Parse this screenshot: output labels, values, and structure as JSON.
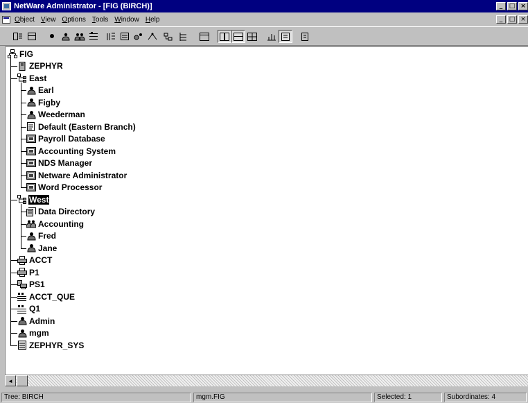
{
  "window": {
    "title": "NetWare Administrator - [FIG (BIRCH)]",
    "controls": [
      "_",
      "□",
      "×"
    ]
  },
  "menubar": {
    "items": [
      "Object",
      "View",
      "Options",
      "Tools",
      "Window",
      "Help"
    ],
    "doc_controls": [
      "_",
      "□",
      "×"
    ]
  },
  "toolbar": {
    "buttons": [
      {
        "name": "create-object-icon"
      },
      {
        "name": "details-icon"
      },
      {
        "name": "search-icon"
      },
      {
        "name": "user-icon"
      },
      {
        "name": "group-icon"
      },
      {
        "name": "queue-icon"
      },
      {
        "name": "browse-icon"
      },
      {
        "name": "browse-alt-icon"
      },
      {
        "name": "rights-icon"
      },
      {
        "name": "filter-icon"
      },
      {
        "name": "partition-icon"
      },
      {
        "name": "tree-view-icon"
      },
      {
        "name": "window-icon"
      },
      {
        "name": "tile-icon"
      },
      {
        "name": "cascade-icon"
      },
      {
        "name": "grid-icon"
      },
      {
        "name": "chart-icon"
      },
      {
        "name": "report-icon"
      },
      {
        "name": "help-icon"
      }
    ]
  },
  "tree": {
    "root": {
      "label": "FIG",
      "icon": "tree-root-icon"
    },
    "items": [
      {
        "label": "ZEPHYR",
        "icon": "server-icon",
        "level": 1
      },
      {
        "label": "East",
        "icon": "organizational-unit-icon",
        "level": 1
      },
      {
        "label": "Earl",
        "icon": "user-icon",
        "level": 2
      },
      {
        "label": "Figby",
        "icon": "user-icon",
        "level": 2
      },
      {
        "label": "Weederman",
        "icon": "user-icon",
        "level": 2
      },
      {
        "label": "Default (Eastern Branch)",
        "icon": "profile-icon",
        "level": 2
      },
      {
        "label": "Payroll Database",
        "icon": "application-icon",
        "level": 2
      },
      {
        "label": "Accounting System",
        "icon": "application-icon",
        "level": 2
      },
      {
        "label": "NDS Manager",
        "icon": "application-icon",
        "level": 2
      },
      {
        "label": "Netware Administrator",
        "icon": "application-icon",
        "level": 2
      },
      {
        "label": "Word Processor",
        "icon": "application-icon",
        "level": 2
      },
      {
        "label": "West",
        "icon": "organizational-unit-icon",
        "level": 1,
        "selected": true
      },
      {
        "label": "Data Directory",
        "icon": "directory-map-icon",
        "level": 2
      },
      {
        "label": "Accounting",
        "icon": "group-icon",
        "level": 2
      },
      {
        "label": "Fred",
        "icon": "user-icon",
        "level": 2
      },
      {
        "label": "Jane",
        "icon": "user-icon",
        "level": 2
      },
      {
        "label": "ACCT",
        "icon": "printer-icon",
        "level": 1
      },
      {
        "label": "P1",
        "icon": "printer-icon",
        "level": 1
      },
      {
        "label": "PS1",
        "icon": "print-server-icon",
        "level": 1
      },
      {
        "label": "ACCT_QUE",
        "icon": "print-queue-icon",
        "level": 1
      },
      {
        "label": "Q1",
        "icon": "print-queue-icon",
        "level": 1
      },
      {
        "label": "Admin",
        "icon": "user-icon",
        "level": 1
      },
      {
        "label": "mgm",
        "icon": "user-icon",
        "level": 1
      },
      {
        "label": "ZEPHYR_SYS",
        "icon": "volume-icon",
        "level": 1
      }
    ]
  },
  "scrollbar": {
    "left_arrow": "◄"
  },
  "statusbar": {
    "tree": "Tree: BIRCH",
    "context": "mgm.FIG",
    "selected": "Selected: 1",
    "subordinates": "Subordinates: 4"
  },
  "colors": {
    "titlebar": "#000080",
    "chrome": "#c0c0c0",
    "selection": "#000000"
  }
}
